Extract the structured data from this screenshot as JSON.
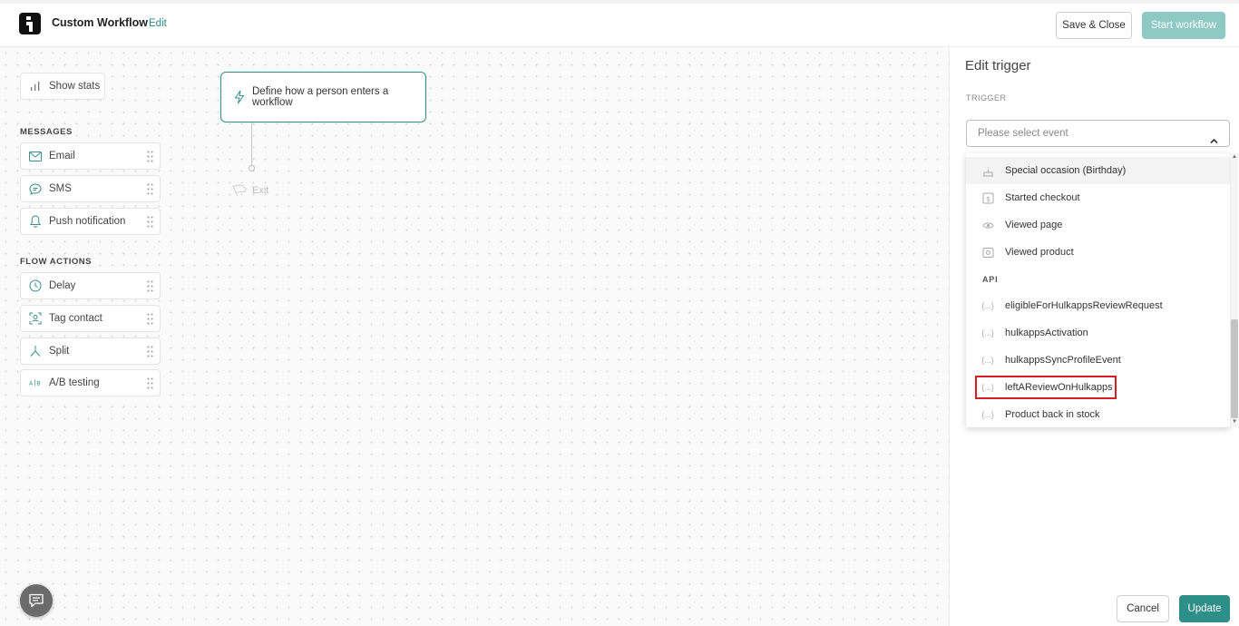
{
  "header": {
    "title": "Custom Workflow",
    "edit_label": "Edit",
    "save_close_label": "Save & Close",
    "start_workflow_label": "Start workflow"
  },
  "canvas": {
    "show_stats_label": "Show stats",
    "messages_section": "MESSAGES",
    "messages": [
      {
        "label": "Email",
        "icon": "mail-icon"
      },
      {
        "label": "SMS",
        "icon": "sms-bubble-icon"
      },
      {
        "label": "Push notification",
        "icon": "bell-icon"
      }
    ],
    "flow_actions_section": "FLOW ACTIONS",
    "flow_actions": [
      {
        "label": "Delay",
        "icon": "clock-icon"
      },
      {
        "label": "Tag contact",
        "icon": "tag-contact-icon"
      },
      {
        "label": "Split",
        "icon": "split-icon"
      },
      {
        "label": "A/B testing",
        "icon": "ab-testing-icon"
      }
    ],
    "trigger_node_label": "Define how a person enters a workflow",
    "exit_label": "Exit"
  },
  "panel": {
    "title": "Edit trigger",
    "trigger_label": "TRIGGER",
    "select_placeholder": "Please select event",
    "dropdown_items": [
      {
        "label": "Special occasion (Birthday)",
        "icon": "cake-icon"
      },
      {
        "label": "Started checkout",
        "icon": "dollar-icon"
      },
      {
        "label": "Viewed page",
        "icon": "eye-icon"
      },
      {
        "label": "Viewed product",
        "icon": "product-icon"
      }
    ],
    "api_group_label": "API",
    "api_items": [
      {
        "label": "eligibleForHulkappsReviewRequest",
        "icon": "braces-icon"
      },
      {
        "label": "hulkappsActivation",
        "icon": "braces-icon"
      },
      {
        "label": "hulkappsSyncProfileEvent",
        "icon": "braces-icon"
      },
      {
        "label": "leftAReviewOnHulkapps",
        "icon": "braces-icon"
      },
      {
        "label": "Product back in stock",
        "icon": "braces-icon"
      }
    ],
    "braces_glyph": "{...}",
    "cancel_label": "Cancel",
    "update_label": "Update"
  },
  "colors": {
    "accent": "#2e8f89",
    "accent_disabled": "#8ec9c4",
    "highlight": "#d42020"
  }
}
